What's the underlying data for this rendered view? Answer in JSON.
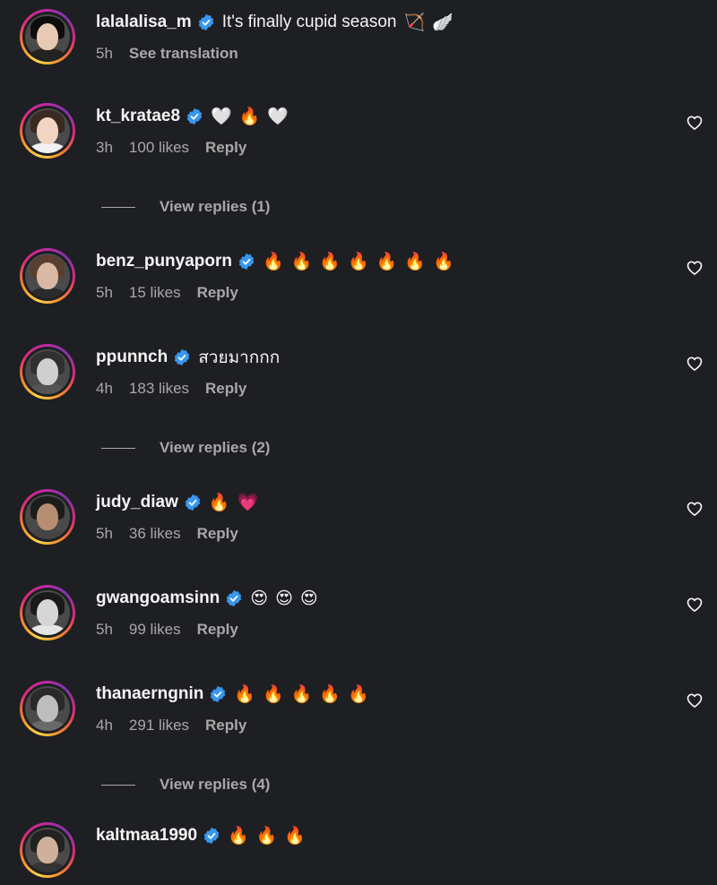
{
  "comments": [
    {
      "username": "lalalalisa_m",
      "text": "It's finally cupid season",
      "emojis": [
        "🏹",
        "🪽"
      ],
      "time": "5h",
      "likes": "",
      "action": "See translation",
      "has_heart": false,
      "avatar": {
        "skin": "#e8c9b4",
        "hair": "#0d0d0d",
        "body": "#222"
      }
    },
    {
      "username": "kt_kratae8",
      "text": "",
      "emojis": [
        "🤍",
        "🔥",
        "🤍"
      ],
      "time": "3h",
      "likes": "100 likes",
      "action": "Reply",
      "has_heart": true,
      "avatar": {
        "skin": "#f1d4c1",
        "hair": "#3a2b22",
        "body": "#f2f2f2"
      }
    },
    {
      "username": "benz_punyaporn",
      "text": "",
      "emojis": [
        "🔥",
        "🔥",
        "🔥",
        "🔥",
        "🔥",
        "🔥",
        "🔥"
      ],
      "time": "5h",
      "likes": "15 likes",
      "action": "Reply",
      "has_heart": true,
      "avatar": {
        "skin": "#d9b9a3",
        "hair": "#5a3e2f",
        "body": "#2b2b2b"
      }
    },
    {
      "username": "ppunnch",
      "text": "สวยมากกก",
      "emojis": [],
      "time": "4h",
      "likes": "183 likes",
      "action": "Reply",
      "has_heart": true,
      "avatar": {
        "skin": "#cfcfcf",
        "hair": "#303030",
        "body": "#555"
      }
    },
    {
      "username": "judy_diaw",
      "text": "",
      "emojis": [
        "🔥",
        "💗"
      ],
      "time": "5h",
      "likes": "36 likes",
      "action": "Reply",
      "has_heart": true,
      "avatar": {
        "skin": "#b88e72",
        "hair": "#1c1c1c",
        "body": "#444"
      }
    },
    {
      "username": "gwangoamsinn",
      "text": "",
      "emojis": [
        "😍",
        "😍",
        "😍"
      ],
      "time": "5h",
      "likes": "99 likes",
      "action": "Reply",
      "has_heart": true,
      "avatar": {
        "skin": "#d6d6d6",
        "hair": "#1a1a1a",
        "body": "#e5e5e5"
      }
    },
    {
      "username": "thanaerngnin",
      "text": "",
      "emojis": [
        "🔥",
        "🔥",
        "🔥",
        "🔥",
        "🔥"
      ],
      "time": "4h",
      "likes": "291 likes",
      "action": "Reply",
      "has_heart": true,
      "avatar": {
        "skin": "#bdbdbd",
        "hair": "#2a2a2a",
        "body": "#6a6a6a"
      }
    },
    {
      "username": "kaltmaa1990",
      "text": "",
      "emojis": [
        "🔥",
        "🔥",
        "🔥"
      ],
      "time": "",
      "likes": "",
      "action": "",
      "has_heart": false,
      "avatar": {
        "skin": "#d0b09a",
        "hair": "#222",
        "body": "#333"
      }
    }
  ],
  "view_replies": [
    {
      "label": "View replies (1)"
    },
    {
      "label": "View replies (2)"
    },
    {
      "label": "View replies (4)"
    }
  ],
  "colors": {
    "background": "#1e1f23",
    "text": "#f5f5f5",
    "muted": "#a8a8a8",
    "verified": "#3897f0"
  },
  "icons": {
    "verified": "verified-badge-icon",
    "like": "heart-outline-icon"
  }
}
